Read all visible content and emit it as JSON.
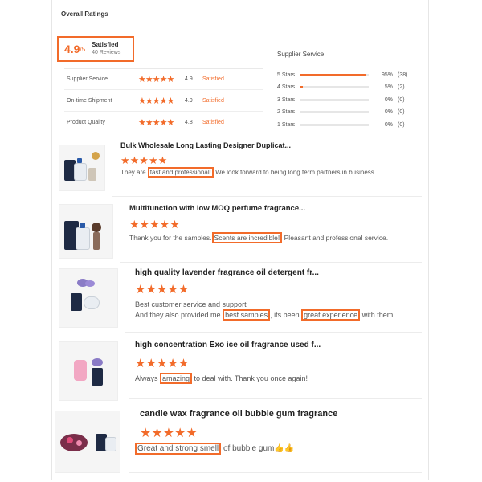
{
  "overall": {
    "title": "Overall Ratings",
    "score": "4.9",
    "score_denominator": "/5",
    "level": "Satisfied",
    "reviews_count": "40 Reviews"
  },
  "metrics": [
    {
      "name": "Supplier Service",
      "stars": "★★★★★",
      "score": "4.9",
      "level": "Satisfied"
    },
    {
      "name": "On-time Shipment",
      "stars": "★★★★★",
      "score": "4.9",
      "level": "Satisfied"
    },
    {
      "name": "Product Quality",
      "stars": "★★★★★",
      "score": "4.8",
      "level": "Satisfied"
    }
  ],
  "supplier_service": {
    "title": "Supplier Service",
    "distribution": [
      {
        "label": "5 Stars",
        "percent": "95%",
        "count": "(38)",
        "fill": 0.95
      },
      {
        "label": "4 Stars",
        "percent": "5%",
        "count": "(2)",
        "fill": 0.05
      },
      {
        "label": "3 Stars",
        "percent": "0%",
        "count": "(0)",
        "fill": 0
      },
      {
        "label": "2 Stars",
        "percent": "0%",
        "count": "(0)",
        "fill": 0
      },
      {
        "label": "1 Stars",
        "percent": "0%",
        "count": "(0)",
        "fill": 0
      }
    ]
  },
  "reviews": [
    {
      "title": "Bulk Wholesale Long Lasting Designer Duplicat...",
      "stars": "★★★★★",
      "text_before": "They are ",
      "text_highlight": "fast and professional!",
      "text_after": " We look forward to being long term partners in business."
    },
    {
      "title": "Multifunction with low MOQ perfume fragrance...",
      "stars": "★★★★★",
      "text_before": "Thank you for the samples.",
      "text_highlight": "Scents are incredible!",
      "text_after": " Pleasant and professional service."
    },
    {
      "title": "high quality lavender fragrance oil detergent fr...",
      "stars": "★★★★★",
      "line1": "Best customer service and support",
      "line2_before": "And they also provided me ",
      "line2_highlight1": "best samples",
      "line2_middle": ", its been ",
      "line2_highlight2": "great experience",
      "line2_after": " with them"
    },
    {
      "title": "high concentration Exo ice oil fragrance used f...",
      "stars": "★★★★★",
      "text_before": "Always ",
      "text_highlight": "amazing",
      "text_after": " to deal with. Thank you once again!"
    },
    {
      "title": "candle wax fragrance oil bubble gum fragrance",
      "stars": "★★★★★",
      "text_before": "",
      "text_highlight": "Great and strong smell",
      "text_after": " of bubble gum👍👍"
    }
  ],
  "colors": {
    "accent": "#f26b2a",
    "text": "#333333",
    "muted": "#777777"
  }
}
